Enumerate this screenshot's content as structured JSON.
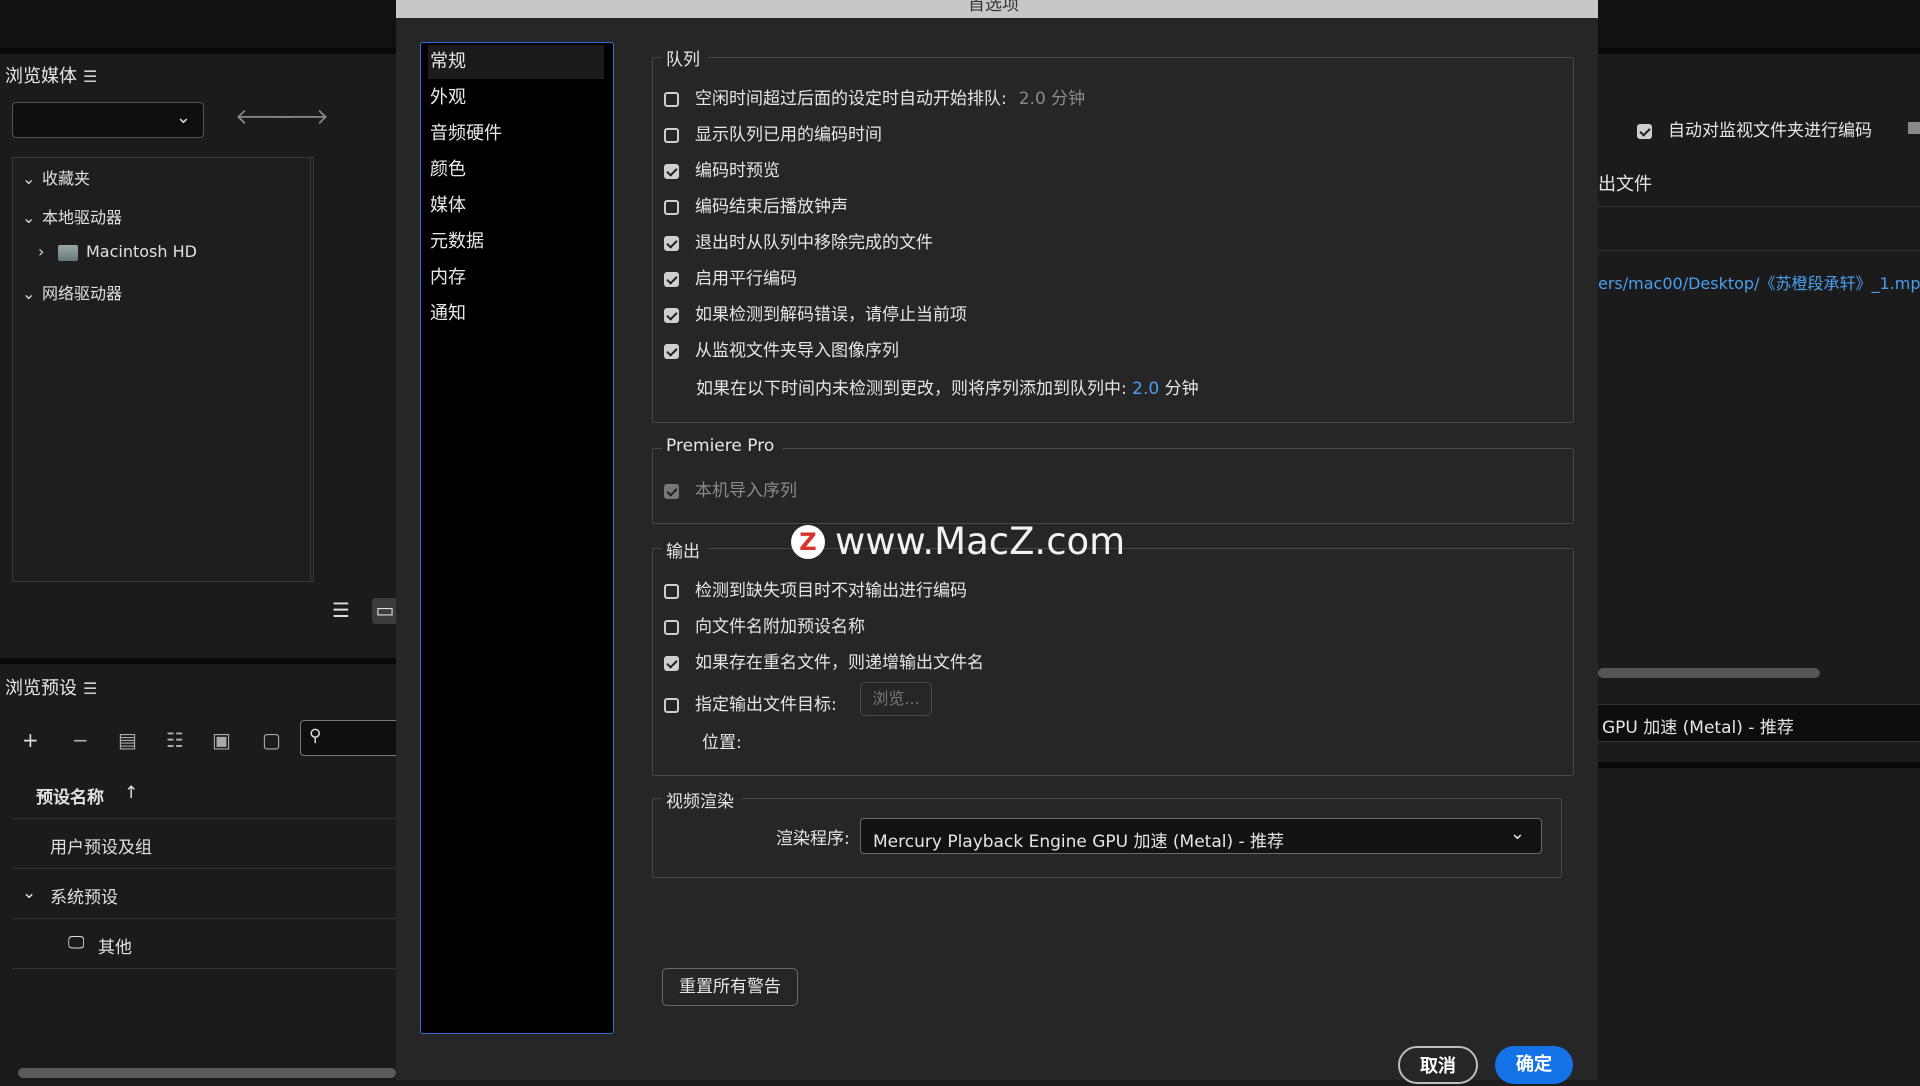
{
  "dialog": {
    "title": "首选项",
    "nav": [
      "常规",
      "外观",
      "音频硬件",
      "颜色",
      "媒体",
      "元数据",
      "内存",
      "通知"
    ],
    "queue": {
      "label": "队列",
      "items": [
        {
          "label": "空闲时间超过后面的设定时自动开始排队:",
          "checked": false,
          "value": "2.0 分钟"
        },
        {
          "label": "显示队列已用的编码时间",
          "checked": false
        },
        {
          "label": "编码时预览",
          "checked": true
        },
        {
          "label": "编码结束后播放钟声",
          "checked": false
        },
        {
          "label": "退出时从队列中移除完成的文件",
          "checked": true
        },
        {
          "label": "启用平行编码",
          "checked": true
        },
        {
          "label": "如果检测到解码错误，请停止当前项",
          "checked": true
        },
        {
          "label": "从监视文件夹导入图像序列",
          "checked": true
        }
      ],
      "sequence_note": "如果在以下时间内未检测到更改，则将序列添加到队列中:",
      "sequence_value": "2.0",
      "sequence_unit": "分钟"
    },
    "premiere": {
      "label": "Premiere Pro",
      "item": {
        "label": "本机导入序列",
        "checked": true,
        "disabled": true
      }
    },
    "output": {
      "label": "输出",
      "items": [
        {
          "label": "检测到缺失项目时不对输出进行编码",
          "checked": false
        },
        {
          "label": "向文件名附加预设名称",
          "checked": false
        },
        {
          "label": "如果存在重名文件，则递增输出文件名",
          "checked": true
        },
        {
          "label": "指定输出文件目标:",
          "checked": false
        }
      ],
      "browse_label": "浏览...",
      "location_label": "位置:"
    },
    "render": {
      "label": "视频渲染",
      "renderer_label": "渲染程序:",
      "renderer_value": "Mercury Playback Engine GPU 加速 (Metal) - 推荐"
    },
    "reset_label": "重置所有警告",
    "cancel_label": "取消",
    "ok_label": "确定"
  },
  "background": {
    "media_browser_title": "浏览媒体",
    "tree": [
      "收藏夹",
      "本地驱动器",
      "Macintosh HD",
      "网络驱动器"
    ],
    "presets_title": "浏览预设",
    "preset_name_header": "预设名称",
    "preset_rows": [
      "用户预设及组",
      "系统预设",
      "其他"
    ],
    "watch_folder_check": "自动对监视文件夹进行编码",
    "file_header": "出文件",
    "output_path": "ers/mac00/Desktop/《苏橙段承轩》_1.mp",
    "gpu_text": "GPU 加速 (Metal) - 推荐"
  },
  "watermark": {
    "logo": "Z",
    "text": "www.MacZ.com"
  }
}
